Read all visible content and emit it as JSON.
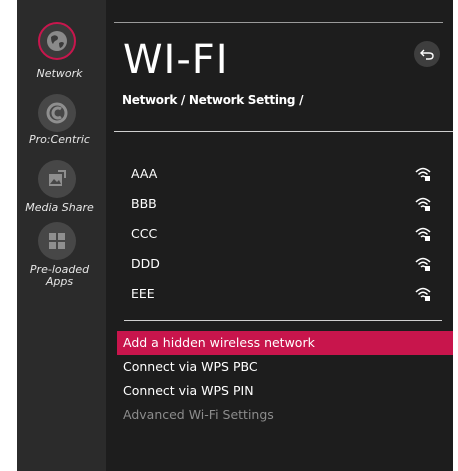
{
  "sidebar": {
    "items": [
      {
        "label": "Network",
        "icon": "globe-icon",
        "active": true
      },
      {
        "label": "Pro:Centric",
        "icon": "procentric-icon",
        "active": false
      },
      {
        "label": "Media Share",
        "icon": "media-share-icon",
        "active": false
      },
      {
        "label": "Pre-loaded Apps",
        "icon": "apps-grid-icon",
        "active": false
      }
    ]
  },
  "header": {
    "title": "WI-FI",
    "breadcrumb": "Network / Network Setting /"
  },
  "networks": [
    {
      "ssid": "AAA",
      "icon": "wifi-lock-icon"
    },
    {
      "ssid": "BBB",
      "icon": "wifi-lock-icon"
    },
    {
      "ssid": "CCC",
      "icon": "wifi-lock-icon"
    },
    {
      "ssid": "DDD",
      "icon": "wifi-lock-icon"
    },
    {
      "ssid": "EEE",
      "icon": "wifi-lock-icon"
    }
  ],
  "menu": {
    "items": [
      {
        "label": "Add a hidden wireless network",
        "state": "selected"
      },
      {
        "label": "Connect via WPS PBC",
        "state": "normal"
      },
      {
        "label": "Connect via WPS PIN",
        "state": "normal"
      },
      {
        "label": "Advanced Wi-Fi Settings",
        "state": "disabled"
      }
    ]
  },
  "colors": {
    "accent": "#c8154c",
    "background": "#1d1d1d",
    "sidebar": "#2b2b2b"
  }
}
